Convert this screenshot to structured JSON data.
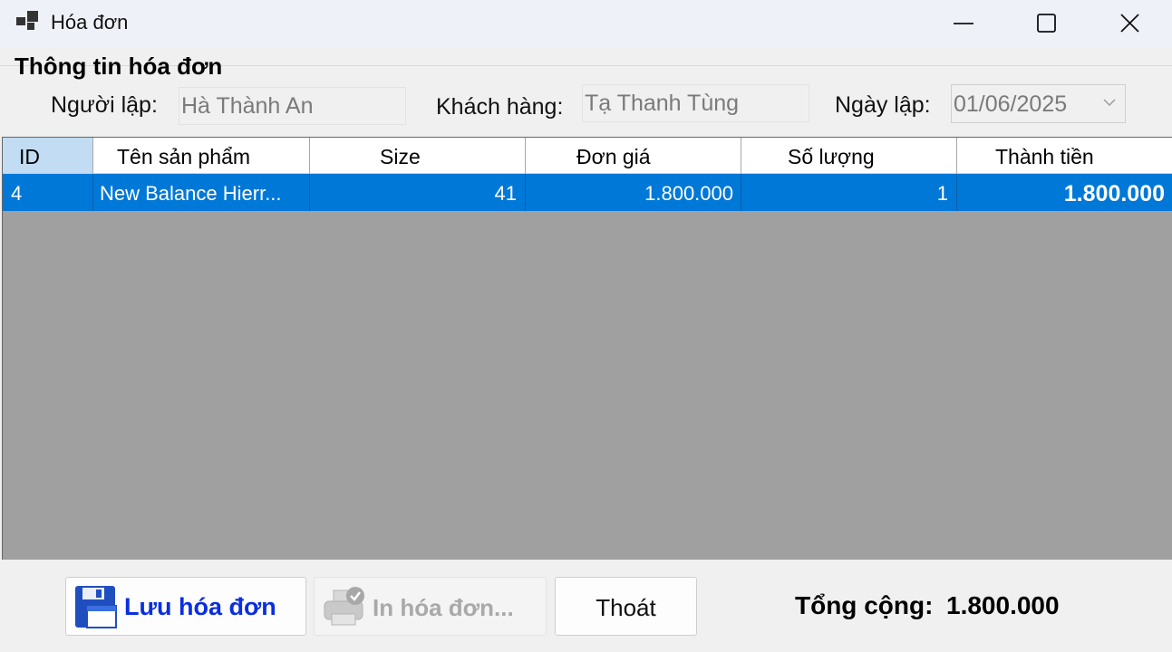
{
  "window": {
    "title": "Hóa đơn",
    "icons": {
      "app": "windows-form-icon",
      "minimize": "minimize-icon",
      "maximize": "maximize-icon",
      "close": "close-icon"
    }
  },
  "info": {
    "section_title": "Thông tin hóa đơn",
    "creator_label": "Người lập:",
    "creator_value": "Hà Thành An",
    "customer_label": "Khách hàng:",
    "customer_value": "Tạ Thanh Tùng",
    "date_label": "Ngày lập:",
    "date_value": "01/06/2025"
  },
  "grid": {
    "columns": [
      "ID",
      "Tên sản phẩm",
      "Size",
      "Đơn giá",
      "Số lượng",
      "Thành tiền"
    ],
    "rows": [
      {
        "id": "4",
        "name": "New Balance Hierr...",
        "size": "41",
        "price": "1.800.000",
        "qty": "1",
        "total": "1.800.000"
      }
    ],
    "colors": {
      "selected_row": "#0078d7",
      "empty_area": "#a0a0a0",
      "selected_header": "#c1dcf3"
    }
  },
  "actions": {
    "save_label": "Lưu hóa đơn",
    "print_label": "In hóa đơn...",
    "exit_label": "Thoát",
    "save_color": "#0a2ee0",
    "icons": {
      "save": "floppy-disk-icon",
      "print": "printer-icon"
    }
  },
  "summary": {
    "total_label": "Tổng cộng:",
    "total_value": "1.800.000"
  }
}
